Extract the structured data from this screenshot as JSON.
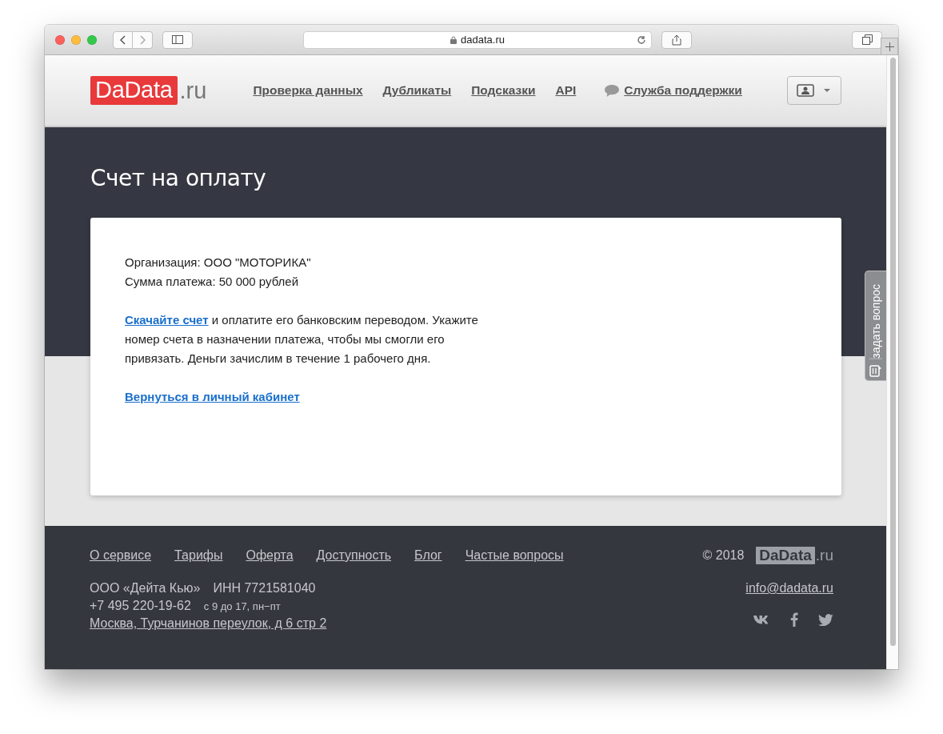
{
  "browser": {
    "url": "dadata.ru"
  },
  "header": {
    "logo": "DaData",
    "logo_suffix": ".ru",
    "nav": [
      {
        "label": "Проверка данных",
        "kind": "link"
      },
      {
        "label": "Дубликаты",
        "kind": "link"
      },
      {
        "label": "Подсказки",
        "kind": "link"
      },
      {
        "label": "API",
        "kind": "link"
      },
      {
        "label": "Служба поддержки",
        "kind": "support"
      }
    ]
  },
  "page": {
    "title": "Счет на оплату"
  },
  "card": {
    "lines": [
      "Организация: ООО \"МОТОРИКА\"",
      "Сумма платежа: 50 000 рублей"
    ],
    "instruction_link": "Скачайте счет",
    "instruction_text": " и оплатите его банковским переводом. Укажите номер счета в назначении платежа, чтобы мы смогли его привязать. Деньги зачислим в течение 1 рабочего дня.",
    "back_link": "Вернуться в личный кабинет"
  },
  "feedback_tab": {
    "label": "задать вопрос"
  },
  "footer": {
    "links": [
      "О сервисе",
      "Тарифы",
      "Оферта",
      "Доступность",
      "Блог",
      "Частые вопросы"
    ],
    "copyright": "© 2018",
    "logo": "DaData",
    "logo_suffix": ".ru",
    "company": "ООО «Дейта Кью»",
    "inn": "ИНН 7721581040",
    "phone": "+7 495 220-19-62",
    "hours": "с 9 до 17, пн−пт",
    "address": "Москва, Турчанинов переулок, д 6 стр 2",
    "email": "info@dadata.ru"
  }
}
